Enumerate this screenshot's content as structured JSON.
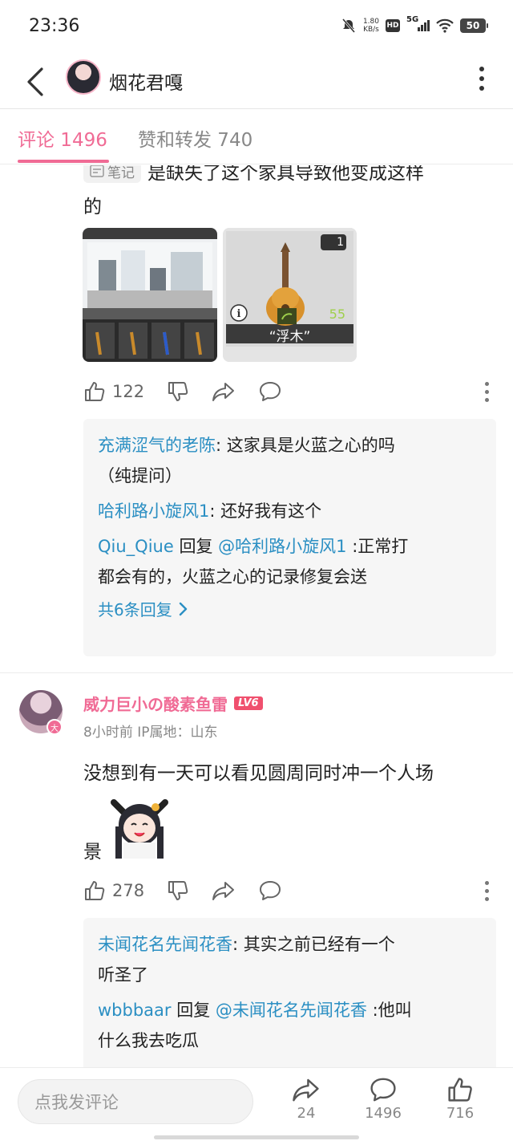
{
  "status_bar": {
    "time": "23:36",
    "net_speed_value": "1.80",
    "net_speed_unit": "KB/s",
    "hd_label": "HD",
    "signal_label": "5G",
    "battery": "50",
    "icons": [
      "mute-icon",
      "hd-icon",
      "signal-5g-icon",
      "wifi-icon",
      "battery-icon"
    ]
  },
  "header": {
    "title": "烟花君嘎",
    "back_icon": "chevron-left-icon",
    "more_icon": "vertical-dots-icon"
  },
  "tabs": [
    {
      "label": "评论 1496",
      "active": true
    },
    {
      "label": "赞和转发 740",
      "active": false
    }
  ],
  "comment1": {
    "note_tag": "笔记",
    "text_line1": "是缺失了这个家具导致他变成这样",
    "text_line2": "的",
    "image_b_label": "“浮木”",
    "image_b_count": "1",
    "image_b_value": "55",
    "actions": {
      "likes": "122"
    },
    "replies": [
      {
        "user": "充满涩气的老陈",
        "sep": ": ",
        "text_line1": "这家具是火蓝之心的吗",
        "text_line2": "（纯提问）"
      },
      {
        "user": "哈利路小旋风1",
        "sep": ": ",
        "text_line1": "还好我有这个"
      },
      {
        "user": "Qiu_Qiue",
        "reply_word": " 回复 ",
        "mention": "@哈利路小旋风1",
        "text_line1": " :正常打",
        "text_line2": "都会有的，火蓝之心的记录修复会送"
      }
    ],
    "more_replies": "共6条回复"
  },
  "comment2": {
    "user": "威力巨小の酸素鱼雷",
    "level": "LV6",
    "time": "8小时前",
    "ip": "IP属地：山东",
    "text_line1": "没想到有一天可以看见圆周同时冲一个人场",
    "text_line2": "景",
    "actions": {
      "likes": "278"
    },
    "replies": [
      {
        "user": "未闻花名先闻花香",
        "sep": ": ",
        "text_line1": "其实之前已经有一个",
        "text_line2": "听圣了"
      },
      {
        "user": "wbbbaar",
        "reply_word": " 回复 ",
        "mention": "@未闻花名先闻花香",
        "text_line1": " :他叫",
        "text_line2": "什么我去吃瓜"
      }
    ]
  },
  "bottom_bar": {
    "input_placeholder": "点我发评论",
    "share_count": "24",
    "comment_count": "1496",
    "like_count": "716"
  },
  "colors": {
    "accent_pink": "#f06b95",
    "link_blue": "#2b8fc3",
    "level_red": "#f0506e"
  }
}
